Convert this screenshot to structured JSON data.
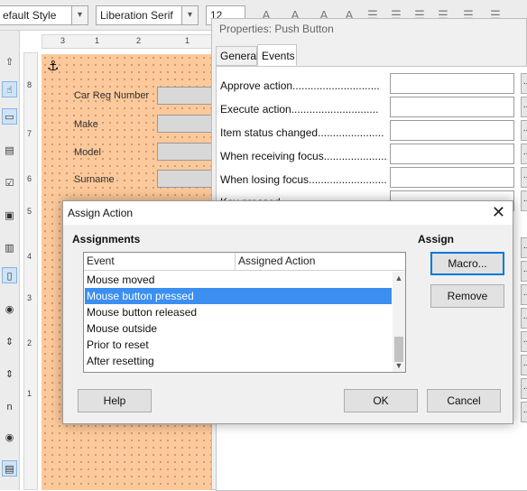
{
  "toolbar": {
    "style_combo": "efault Style",
    "font_combo": "Liberation Serif",
    "size_combo": "12"
  },
  "ruler_top": [
    "3",
    "1",
    "2",
    "1"
  ],
  "ruler_left": [
    "8",
    "7",
    "6",
    "5",
    "4",
    "3",
    "2",
    "1"
  ],
  "form": {
    "labels": [
      "Car Reg Number",
      "Make",
      "Model",
      "Surname"
    ]
  },
  "properties": {
    "title": "Properties: Push Button",
    "tabs": [
      "General",
      "Events"
    ],
    "rows": [
      "Approve action.............................",
      "Execute action.............................",
      "Item status changed......................",
      "When receiving focus.......................",
      "When losing focus..........................",
      "Key pressed"
    ],
    "ellipsis": "..."
  },
  "dialog": {
    "title": "Assign Action",
    "close": "✕",
    "assignments_label": "Assignments",
    "assign_label": "Assign",
    "columns": [
      "Event",
      "Assigned Action"
    ],
    "events": [
      "Mouse moved",
      "Mouse button pressed",
      "Mouse button released",
      "Mouse outside",
      "Prior to reset",
      "After resetting"
    ],
    "selected_event": "Mouse button pressed",
    "buttons": {
      "macro": "Macro...",
      "remove": "Remove",
      "help": "Help",
      "ok": "OK",
      "cancel": "Cancel"
    }
  }
}
